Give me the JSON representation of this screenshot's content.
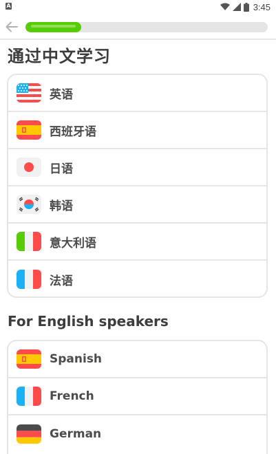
{
  "status_bar": {
    "time": "3:45",
    "notification_icon": "a-notification-icon",
    "icons": [
      "wifi-icon",
      "signal-icon",
      "battery-icon"
    ]
  },
  "top_bar": {
    "back_icon": "arrow-left-icon",
    "progress": 0.23,
    "progress_color": "#58cc02"
  },
  "sections": [
    {
      "title": "通过中文学习",
      "languages": [
        {
          "label": "英语",
          "flag": "us-flag-icon"
        },
        {
          "label": "西班牙语",
          "flag": "spain-flag-icon"
        },
        {
          "label": "日语",
          "flag": "japan-flag-icon"
        },
        {
          "label": "韩语",
          "flag": "korea-flag-icon"
        },
        {
          "label": "意大利语",
          "flag": "italy-flag-icon"
        },
        {
          "label": "法语",
          "flag": "france-flag-icon"
        }
      ]
    },
    {
      "title": "For English speakers",
      "languages": [
        {
          "label": "Spanish",
          "flag": "spain-flag-icon"
        },
        {
          "label": "French",
          "flag": "france-flag-icon"
        },
        {
          "label": "German",
          "flag": "germany-flag-icon"
        }
      ]
    }
  ]
}
